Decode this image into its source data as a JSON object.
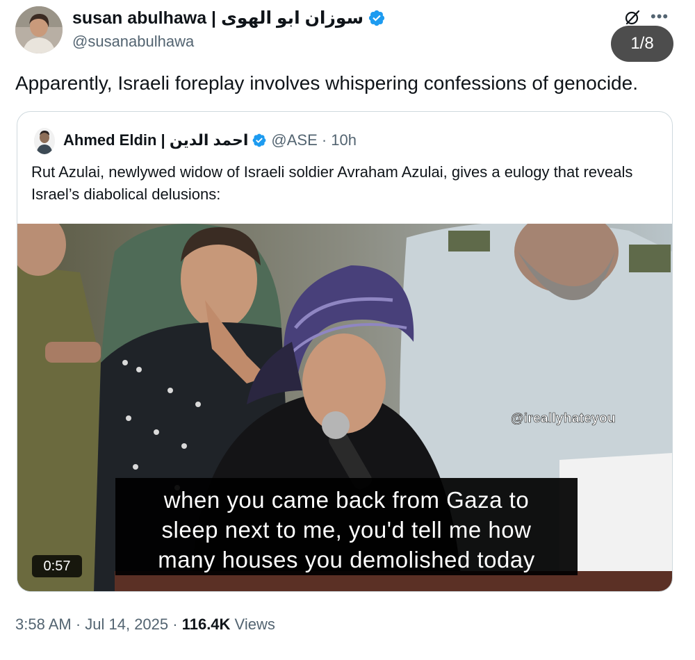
{
  "tweet": {
    "author_name": "susan abulhawa | سوزان ابو الهوى",
    "author_handle": "@susanabulhawa",
    "text": "Apparently, Israeli foreplay involves whispering confessions of genocide.",
    "media_counter": "1/8",
    "timestamp": "3:58 AM · Jul 14, 2025 · ",
    "views_count": "116.4K",
    "views_label": " Views"
  },
  "quoted_tweet": {
    "author_name": "Ahmed Eldin | احمد الدين",
    "handle_time": "@ASE · 10h",
    "text": "Rut Azulai, newlywed widow of  Israeli soldier Avraham Azulai, gives a eulogy that reveals Israel’s diabolical delusions:",
    "video": {
      "watermark": "@ireallyhateyou",
      "caption_lines": [
        "when you came back from Gaza to",
        "sleep next to me, you'd tell me how",
        "many houses you demolished today"
      ],
      "duration": "0:57"
    }
  },
  "icons": {
    "verified": "verified-badge-icon",
    "grok": "grok-icon",
    "more": "more-options-icon"
  },
  "colors": {
    "verified_blue": "#1d9bf0",
    "secondary_text": "#536471",
    "primary_text": "#0f1419"
  }
}
